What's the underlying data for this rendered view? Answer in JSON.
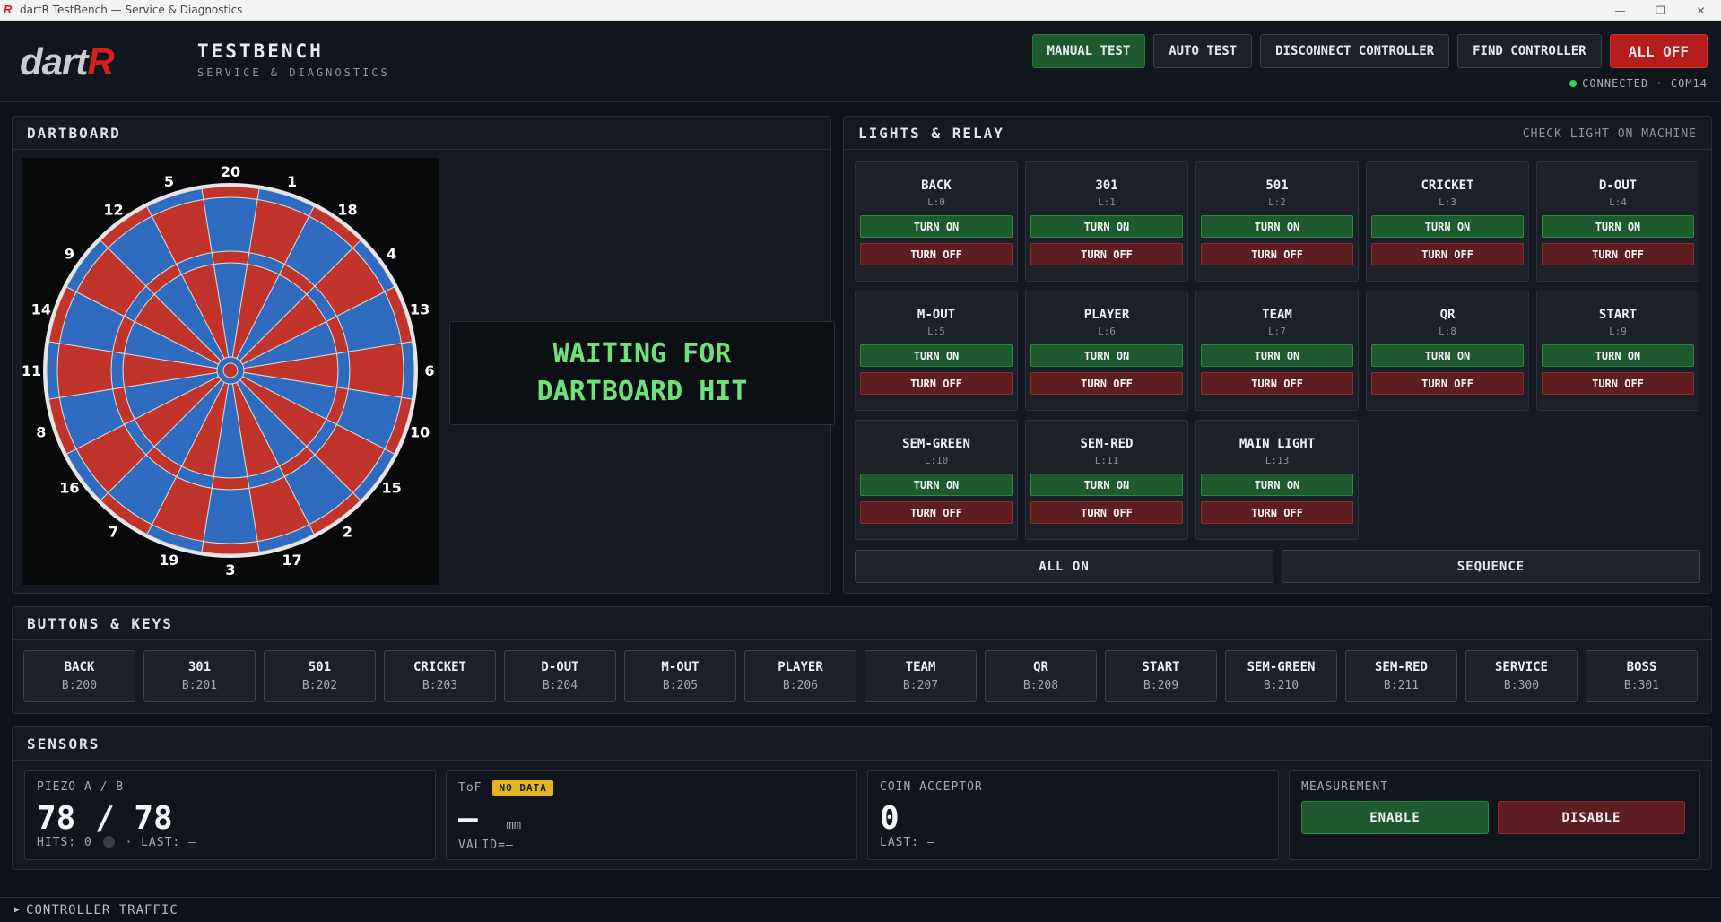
{
  "window": {
    "title": "dartR TestBench — Service & Diagnostics",
    "app_icon_letter": "R",
    "minimize": "—",
    "maximize": "❐",
    "close": "✕"
  },
  "header": {
    "logo_text": "dartR",
    "brand_title": "TESTBENCH",
    "brand_subtitle": "SERVICE & DIAGNOSTICS",
    "buttons": {
      "manual_test": "MANUAL TEST",
      "auto_test": "AUTO TEST",
      "disconnect": "DISCONNECT CONTROLLER",
      "find": "FIND CONTROLLER",
      "all_off": "ALL OFF"
    },
    "status": "CONNECTED · COM14",
    "status_color": "#3ecf5a"
  },
  "dartboard": {
    "title": "DARTBOARD",
    "waiting_text": "WAITING FOR\nDARTBOARD HIT",
    "numbers": [
      "20",
      "1",
      "18",
      "4",
      "13",
      "6",
      "10",
      "15",
      "2",
      "17",
      "3",
      "19",
      "7",
      "16",
      "8",
      "11",
      "14",
      "9",
      "12",
      "5"
    ],
    "colors": {
      "red": "#c0342b",
      "blue": "#2f6cc0"
    }
  },
  "lights": {
    "title": "LIGHTS & RELAY",
    "hint": "CHECK LIGHT ON MACHINE",
    "on_label": "TURN ON",
    "off_label": "TURN OFF",
    "items": [
      {
        "name": "BACK",
        "id": "L:0"
      },
      {
        "name": "301",
        "id": "L:1"
      },
      {
        "name": "501",
        "id": "L:2"
      },
      {
        "name": "CRICKET",
        "id": "L:3"
      },
      {
        "name": "D-OUT",
        "id": "L:4"
      },
      {
        "name": "M-OUT",
        "id": "L:5"
      },
      {
        "name": "PLAYER",
        "id": "L:6"
      },
      {
        "name": "TEAM",
        "id": "L:7"
      },
      {
        "name": "QR",
        "id": "L:8"
      },
      {
        "name": "START",
        "id": "L:9"
      },
      {
        "name": "SEM-GREEN",
        "id": "L:10"
      },
      {
        "name": "SEM-RED",
        "id": "L:11"
      },
      {
        "name": "MAIN LIGHT",
        "id": "L:13"
      }
    ],
    "all_on": "ALL ON",
    "sequence": "SEQUENCE"
  },
  "buttons_keys": {
    "title": "BUTTONS & KEYS",
    "items": [
      {
        "name": "BACK",
        "code": "B:200"
      },
      {
        "name": "301",
        "code": "B:201"
      },
      {
        "name": "501",
        "code": "B:202"
      },
      {
        "name": "CRICKET",
        "code": "B:203"
      },
      {
        "name": "D-OUT",
        "code": "B:204"
      },
      {
        "name": "M-OUT",
        "code": "B:205"
      },
      {
        "name": "PLAYER",
        "code": "B:206"
      },
      {
        "name": "TEAM",
        "code": "B:207"
      },
      {
        "name": "QR",
        "code": "B:208"
      },
      {
        "name": "START",
        "code": "B:209"
      },
      {
        "name": "SEM-GREEN",
        "code": "B:210"
      },
      {
        "name": "SEM-RED",
        "code": "B:211"
      },
      {
        "name": "SERVICE",
        "code": "B:300"
      },
      {
        "name": "BOSS",
        "code": "B:301"
      }
    ]
  },
  "sensors": {
    "title": "SENSORS",
    "piezo": {
      "label": "PIEZO A / B",
      "value": "78 / 78",
      "hits": "HITS: 0",
      "last": "· LAST: —"
    },
    "tof": {
      "label": "ToF",
      "badge": "NO DATA",
      "value": "—",
      "unit": "mm",
      "valid": "VALID=—"
    },
    "coin": {
      "label": "COIN ACCEPTOR",
      "value": "0",
      "last": "LAST: —"
    },
    "measurement": {
      "label": "MEASUREMENT",
      "enable": "ENABLE",
      "disable": "DISABLE"
    }
  },
  "footer": {
    "arrow": "▶",
    "label": "CONTROLLER TRAFFIC"
  }
}
